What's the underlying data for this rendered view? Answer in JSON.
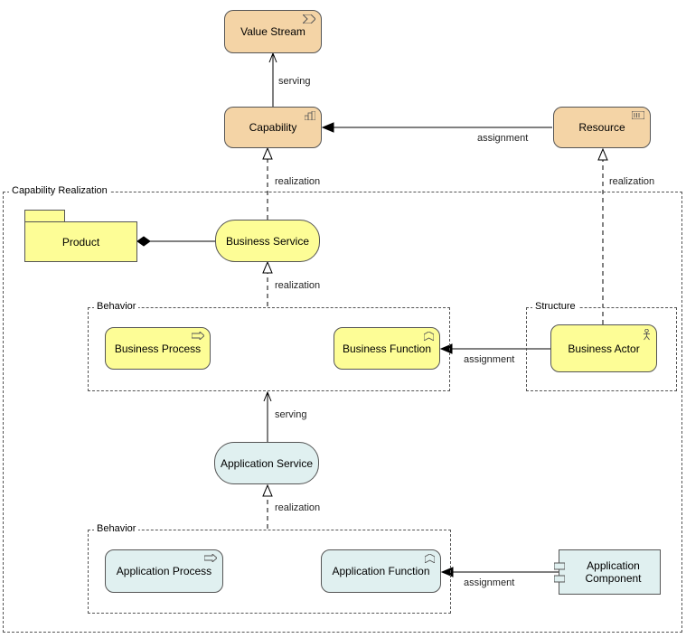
{
  "nodes": {
    "value_stream": "Value Stream",
    "capability": "Capability",
    "resource": "Resource",
    "product": "Product",
    "business_service": "Business Service",
    "business_process": "Business Process",
    "business_function": "Business Function",
    "business_actor": "Business Actor",
    "application_service": "Application Service",
    "application_process": "Application Process",
    "application_function": "Application Function",
    "application_component": "Application Component"
  },
  "groups": {
    "capability_realization": "Capability Realization",
    "behavior1": "Behavior",
    "structure": "Structure",
    "behavior2": "Behavior"
  },
  "relations": {
    "serving1": "serving",
    "assignment1": "assignment",
    "realization1": "realization",
    "realization2": "realization",
    "realization3": "realization",
    "assignment2": "assignment",
    "serving2": "serving",
    "realization4": "realization",
    "assignment3": "assignment"
  }
}
